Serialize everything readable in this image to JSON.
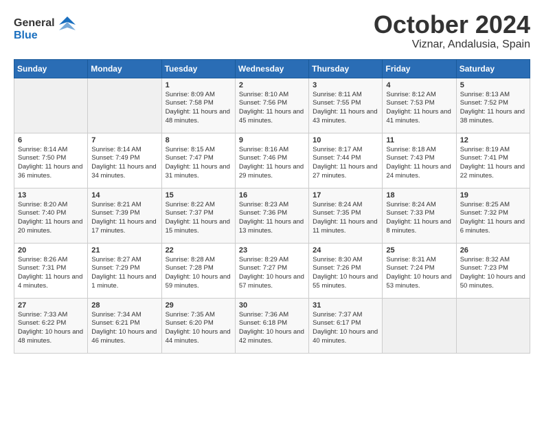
{
  "header": {
    "logo_general": "General",
    "logo_blue": "Blue",
    "month_title": "October 2024",
    "location": "Viznar, Andalusia, Spain"
  },
  "weekdays": [
    "Sunday",
    "Monday",
    "Tuesday",
    "Wednesday",
    "Thursday",
    "Friday",
    "Saturday"
  ],
  "weeks": [
    [
      {
        "day": "",
        "empty": true
      },
      {
        "day": "",
        "empty": true
      },
      {
        "day": "1",
        "sunrise": "Sunrise: 8:09 AM",
        "sunset": "Sunset: 7:58 PM",
        "daylight": "Daylight: 11 hours and 48 minutes."
      },
      {
        "day": "2",
        "sunrise": "Sunrise: 8:10 AM",
        "sunset": "Sunset: 7:56 PM",
        "daylight": "Daylight: 11 hours and 45 minutes."
      },
      {
        "day": "3",
        "sunrise": "Sunrise: 8:11 AM",
        "sunset": "Sunset: 7:55 PM",
        "daylight": "Daylight: 11 hours and 43 minutes."
      },
      {
        "day": "4",
        "sunrise": "Sunrise: 8:12 AM",
        "sunset": "Sunset: 7:53 PM",
        "daylight": "Daylight: 11 hours and 41 minutes."
      },
      {
        "day": "5",
        "sunrise": "Sunrise: 8:13 AM",
        "sunset": "Sunset: 7:52 PM",
        "daylight": "Daylight: 11 hours and 38 minutes."
      }
    ],
    [
      {
        "day": "6",
        "sunrise": "Sunrise: 8:14 AM",
        "sunset": "Sunset: 7:50 PM",
        "daylight": "Daylight: 11 hours and 36 minutes."
      },
      {
        "day": "7",
        "sunrise": "Sunrise: 8:14 AM",
        "sunset": "Sunset: 7:49 PM",
        "daylight": "Daylight: 11 hours and 34 minutes."
      },
      {
        "day": "8",
        "sunrise": "Sunrise: 8:15 AM",
        "sunset": "Sunset: 7:47 PM",
        "daylight": "Daylight: 11 hours and 31 minutes."
      },
      {
        "day": "9",
        "sunrise": "Sunrise: 8:16 AM",
        "sunset": "Sunset: 7:46 PM",
        "daylight": "Daylight: 11 hours and 29 minutes."
      },
      {
        "day": "10",
        "sunrise": "Sunrise: 8:17 AM",
        "sunset": "Sunset: 7:44 PM",
        "daylight": "Daylight: 11 hours and 27 minutes."
      },
      {
        "day": "11",
        "sunrise": "Sunrise: 8:18 AM",
        "sunset": "Sunset: 7:43 PM",
        "daylight": "Daylight: 11 hours and 24 minutes."
      },
      {
        "day": "12",
        "sunrise": "Sunrise: 8:19 AM",
        "sunset": "Sunset: 7:41 PM",
        "daylight": "Daylight: 11 hours and 22 minutes."
      }
    ],
    [
      {
        "day": "13",
        "sunrise": "Sunrise: 8:20 AM",
        "sunset": "Sunset: 7:40 PM",
        "daylight": "Daylight: 11 hours and 20 minutes."
      },
      {
        "day": "14",
        "sunrise": "Sunrise: 8:21 AM",
        "sunset": "Sunset: 7:39 PM",
        "daylight": "Daylight: 11 hours and 17 minutes."
      },
      {
        "day": "15",
        "sunrise": "Sunrise: 8:22 AM",
        "sunset": "Sunset: 7:37 PM",
        "daylight": "Daylight: 11 hours and 15 minutes."
      },
      {
        "day": "16",
        "sunrise": "Sunrise: 8:23 AM",
        "sunset": "Sunset: 7:36 PM",
        "daylight": "Daylight: 11 hours and 13 minutes."
      },
      {
        "day": "17",
        "sunrise": "Sunrise: 8:24 AM",
        "sunset": "Sunset: 7:35 PM",
        "daylight": "Daylight: 11 hours and 11 minutes."
      },
      {
        "day": "18",
        "sunrise": "Sunrise: 8:24 AM",
        "sunset": "Sunset: 7:33 PM",
        "daylight": "Daylight: 11 hours and 8 minutes."
      },
      {
        "day": "19",
        "sunrise": "Sunrise: 8:25 AM",
        "sunset": "Sunset: 7:32 PM",
        "daylight": "Daylight: 11 hours and 6 minutes."
      }
    ],
    [
      {
        "day": "20",
        "sunrise": "Sunrise: 8:26 AM",
        "sunset": "Sunset: 7:31 PM",
        "daylight": "Daylight: 11 hours and 4 minutes."
      },
      {
        "day": "21",
        "sunrise": "Sunrise: 8:27 AM",
        "sunset": "Sunset: 7:29 PM",
        "daylight": "Daylight: 11 hours and 1 minute."
      },
      {
        "day": "22",
        "sunrise": "Sunrise: 8:28 AM",
        "sunset": "Sunset: 7:28 PM",
        "daylight": "Daylight: 10 hours and 59 minutes."
      },
      {
        "day": "23",
        "sunrise": "Sunrise: 8:29 AM",
        "sunset": "Sunset: 7:27 PM",
        "daylight": "Daylight: 10 hours and 57 minutes."
      },
      {
        "day": "24",
        "sunrise": "Sunrise: 8:30 AM",
        "sunset": "Sunset: 7:26 PM",
        "daylight": "Daylight: 10 hours and 55 minutes."
      },
      {
        "day": "25",
        "sunrise": "Sunrise: 8:31 AM",
        "sunset": "Sunset: 7:24 PM",
        "daylight": "Daylight: 10 hours and 53 minutes."
      },
      {
        "day": "26",
        "sunrise": "Sunrise: 8:32 AM",
        "sunset": "Sunset: 7:23 PM",
        "daylight": "Daylight: 10 hours and 50 minutes."
      }
    ],
    [
      {
        "day": "27",
        "sunrise": "Sunrise: 7:33 AM",
        "sunset": "Sunset: 6:22 PM",
        "daylight": "Daylight: 10 hours and 48 minutes."
      },
      {
        "day": "28",
        "sunrise": "Sunrise: 7:34 AM",
        "sunset": "Sunset: 6:21 PM",
        "daylight": "Daylight: 10 hours and 46 minutes."
      },
      {
        "day": "29",
        "sunrise": "Sunrise: 7:35 AM",
        "sunset": "Sunset: 6:20 PM",
        "daylight": "Daylight: 10 hours and 44 minutes."
      },
      {
        "day": "30",
        "sunrise": "Sunrise: 7:36 AM",
        "sunset": "Sunset: 6:18 PM",
        "daylight": "Daylight: 10 hours and 42 minutes."
      },
      {
        "day": "31",
        "sunrise": "Sunrise: 7:37 AM",
        "sunset": "Sunset: 6:17 PM",
        "daylight": "Daylight: 10 hours and 40 minutes."
      },
      {
        "day": "",
        "empty": true
      },
      {
        "day": "",
        "empty": true
      }
    ]
  ]
}
